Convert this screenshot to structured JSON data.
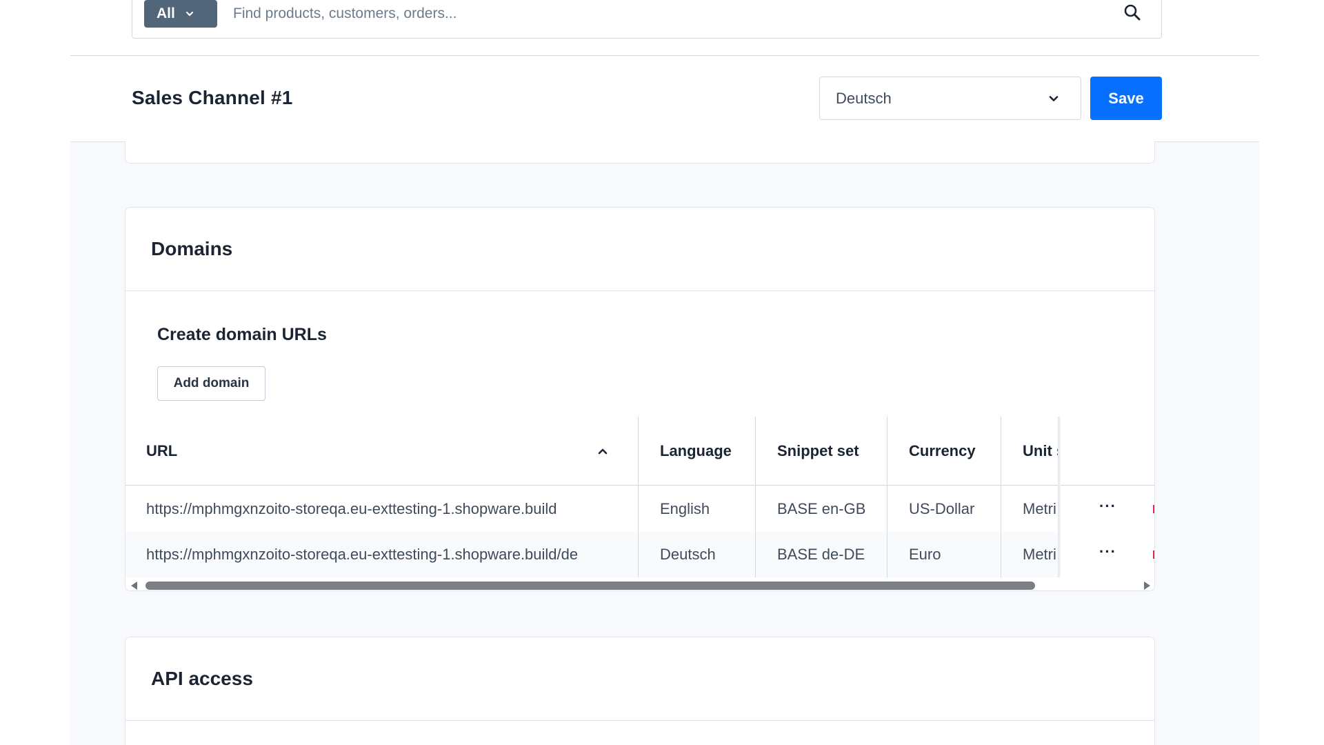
{
  "search": {
    "type_label": "All",
    "placeholder": "Find products, customers, orders..."
  },
  "smartbar": {
    "title": "Sales Channel #1",
    "language_selected": "Deutsch",
    "save_label": "Save"
  },
  "domains": {
    "card_title": "Domains",
    "create_title": "Create domain URLs",
    "add_domain_label": "Add domain",
    "columns": [
      "URL",
      "Language",
      "Snippet set",
      "Currency",
      "Unit s"
    ],
    "rows": [
      {
        "url": "https://mphmgxnzoito-storeqa.eu-exttesting-1.shopware.build",
        "language": "English",
        "snippet_set": "BASE en-GB",
        "currency": "US-Dollar",
        "unit": "Metri"
      },
      {
        "url": "https://mphmgxnzoito-storeqa.eu-exttesting-1.shopware.build/de",
        "language": "Deutsch",
        "snippet_set": "BASE de-DE",
        "currency": "Euro",
        "unit": "Metri"
      }
    ],
    "row_actions": "···"
  },
  "api_access": {
    "card_title": "API access"
  },
  "colors": {
    "primary": "#0870ff",
    "search_type_bg": "#52667a",
    "page_bg": "#f7f9fc",
    "danger": "#de294c"
  }
}
